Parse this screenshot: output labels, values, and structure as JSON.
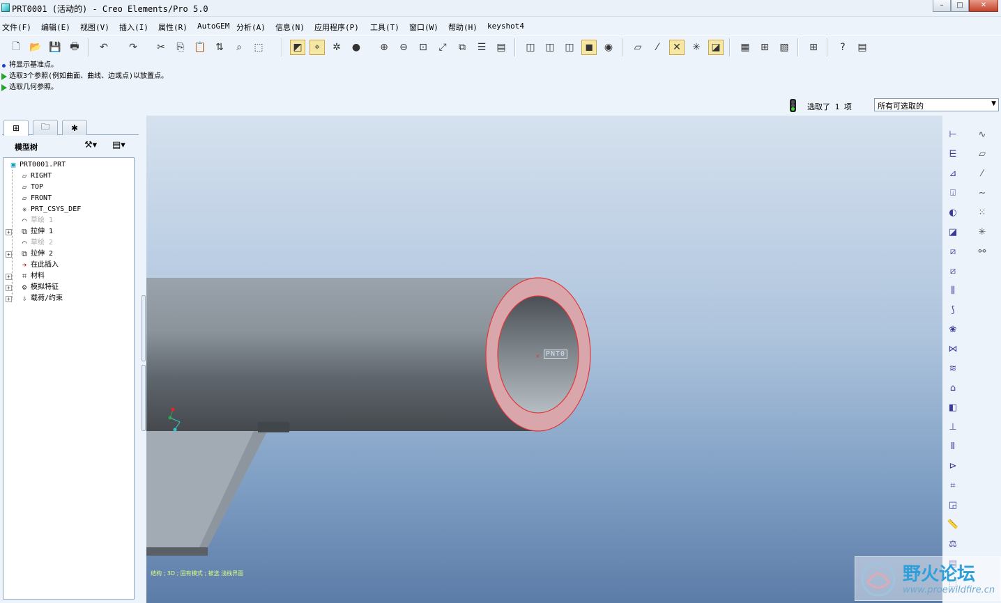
{
  "window": {
    "title": "PRT0001 (活动的) - Creo Elements/Pro 5.0",
    "minimize": "–",
    "maximize": "□",
    "close": "✕"
  },
  "menu": [
    "文件(F)",
    "编辑(E)",
    "视图(V)",
    "插入(I)",
    "属性(R)",
    "AutoGEM",
    "分析(A)",
    "信息(N)",
    "应用程序(P)",
    "工具(T)",
    "窗口(W)",
    "帮助(H)",
    "keyshot4"
  ],
  "messages": [
    {
      "kind": "info",
      "text": "将显示基准点。"
    },
    {
      "kind": "prompt",
      "text": "选取3个参照(例如曲面、曲线、边或点)以放置点。"
    },
    {
      "kind": "prompt",
      "text": "选取几何参照。"
    }
  ],
  "status": {
    "selection_text": "选取了 1 项",
    "filter_value": "所有可选取的"
  },
  "model_tree": {
    "title": "模型树",
    "nodes": [
      {
        "label": "PRT0001.PRT",
        "icon": "part-icon",
        "glyph": "▣",
        "expandable": false,
        "dim": false
      },
      {
        "label": "RIGHT",
        "icon": "datum-plane-icon",
        "glyph": "▱",
        "expandable": false,
        "dim": false
      },
      {
        "label": "TOP",
        "icon": "datum-plane-icon",
        "glyph": "▱",
        "expandable": false,
        "dim": false
      },
      {
        "label": "FRONT",
        "icon": "datum-plane-icon",
        "glyph": "▱",
        "expandable": false,
        "dim": false
      },
      {
        "label": "PRT_CSYS_DEF",
        "icon": "csys-icon",
        "glyph": "✳",
        "expandable": false,
        "dim": false
      },
      {
        "label": "草绘 1",
        "icon": "sketch-icon",
        "glyph": "⌒",
        "expandable": false,
        "dim": true
      },
      {
        "label": "拉伸 1",
        "icon": "extrude-icon",
        "glyph": "⧉",
        "expandable": true,
        "dim": false
      },
      {
        "label": "草绘 2",
        "icon": "sketch-icon",
        "glyph": "⌒",
        "expandable": false,
        "dim": true
      },
      {
        "label": "拉伸 2",
        "icon": "extrude-icon",
        "glyph": "⧉",
        "expandable": true,
        "dim": false
      },
      {
        "label": "在此插入",
        "icon": "insert-here-icon",
        "glyph": "➔",
        "expandable": false,
        "dim": false
      },
      {
        "label": "材料",
        "icon": "material-icon",
        "glyph": "⌗",
        "expandable": true,
        "dim": false
      },
      {
        "label": "模拟特征",
        "icon": "simulation-feature-icon",
        "glyph": "⚙",
        "expandable": true,
        "dim": false
      },
      {
        "label": "载荷/约束",
        "icon": "load-constraint-icon",
        "glyph": "⇩",
        "expandable": true,
        "dim": false
      }
    ]
  },
  "viewport": {
    "point_label": "PNT0",
    "status_line": "结构 ; 3D ; 固有模式 ; 被选 浅栈界面"
  },
  "watermark": {
    "text": "野火论坛",
    "url": "www.proewildfire.cn"
  },
  "colors": {
    "accent": "#c9a64c",
    "selection_highlight": "#e0383a"
  }
}
